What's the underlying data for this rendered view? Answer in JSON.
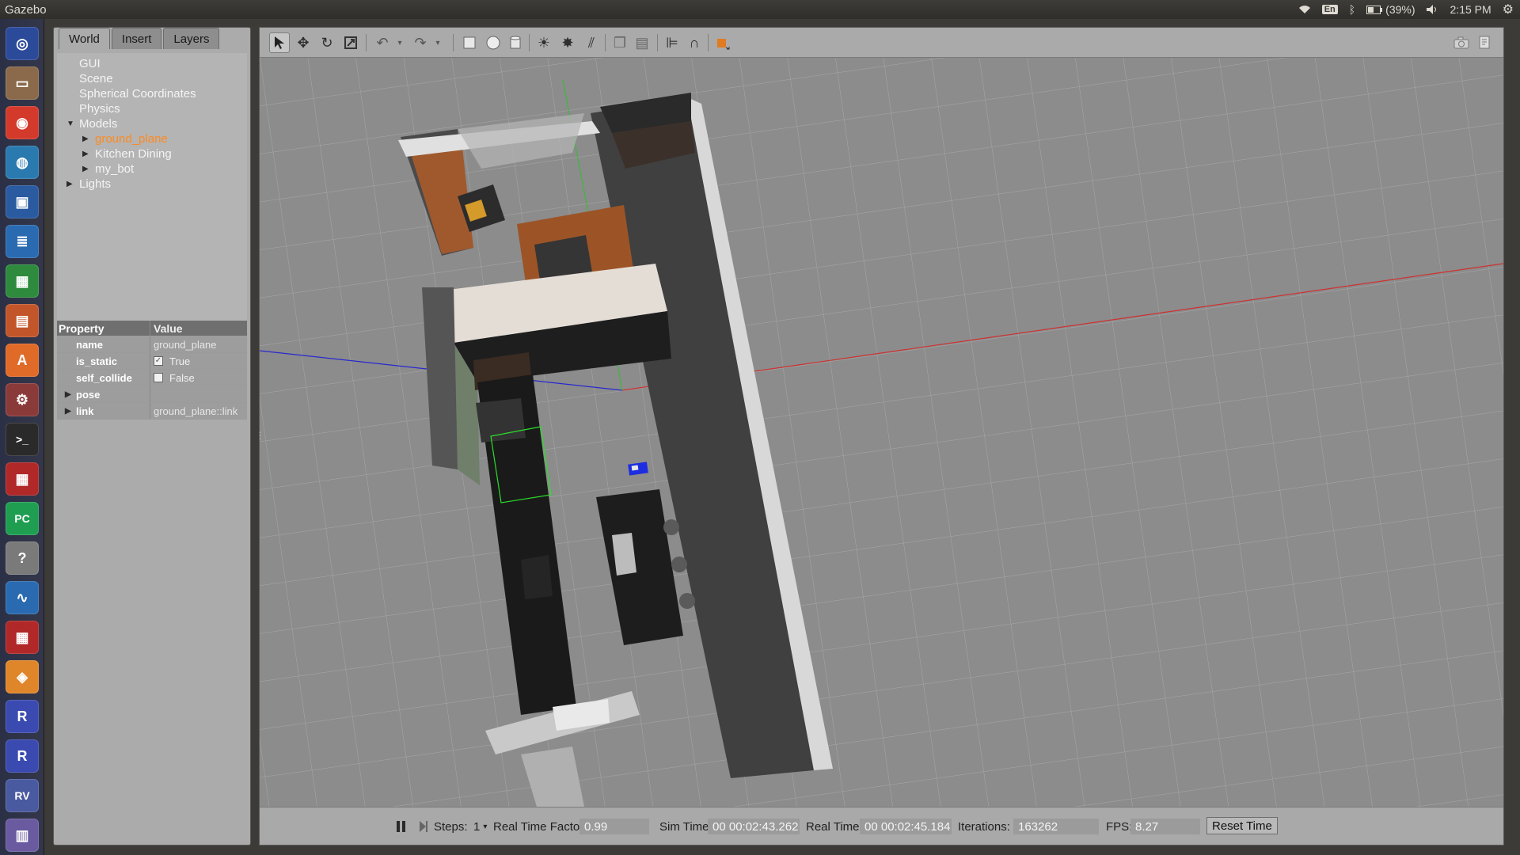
{
  "topbar": {
    "app_title": "Gazebo",
    "keyboard": "En",
    "battery": "(39%)",
    "clock": "2:15 PM"
  },
  "launcher": {
    "items": [
      {
        "name": "ubuntu-dash-icon",
        "color": "#2c4a9a",
        "glyph": "◎"
      },
      {
        "name": "files-icon",
        "color": "#8a6a4a",
        "glyph": "▭"
      },
      {
        "name": "chrome-icon",
        "color": "#d33a2c",
        "glyph": "◉"
      },
      {
        "name": "network-icon",
        "color": "#2a7ab0",
        "glyph": "◍"
      },
      {
        "name": "virtualbox-icon",
        "color": "#2a5aa0",
        "glyph": "▣"
      },
      {
        "name": "writer-icon",
        "color": "#2a6ab0",
        "glyph": "≣"
      },
      {
        "name": "calc-icon",
        "color": "#2e8b3e",
        "glyph": "▦"
      },
      {
        "name": "impress-icon",
        "color": "#c2562a",
        "glyph": "▤"
      },
      {
        "name": "software-center-icon",
        "color": "#e06a28",
        "glyph": "A"
      },
      {
        "name": "settings-icon",
        "color": "#8b3a3a",
        "glyph": "⚙"
      },
      {
        "name": "terminal-icon",
        "color": "#2a2a2a",
        "glyph": ">_"
      },
      {
        "name": "app-red-icon",
        "color": "#b02828",
        "glyph": "▦"
      },
      {
        "name": "pycharm-icon",
        "color": "#1f9e52",
        "glyph": "PC"
      },
      {
        "name": "help-icon",
        "color": "#7a7a7a",
        "glyph": "?"
      },
      {
        "name": "monitor-icon",
        "color": "#2a6ab0",
        "glyph": "∿"
      },
      {
        "name": "app-red-2-icon",
        "color": "#b02828",
        "glyph": "▦"
      },
      {
        "name": "gazebo-icon",
        "color": "#e0862a",
        "glyph": "◈"
      },
      {
        "name": "rqt-icon",
        "color": "#3a4ab0",
        "glyph": "R"
      },
      {
        "name": "rqt-2-icon",
        "color": "#3a4ab0",
        "glyph": "R"
      },
      {
        "name": "rviz-icon",
        "color": "#4a5aa0",
        "glyph": "RV"
      },
      {
        "name": "trash-icon",
        "color": "#6a5aa0",
        "glyph": "▥"
      }
    ]
  },
  "tabs": [
    "World",
    "Insert",
    "Layers"
  ],
  "tree": {
    "gui": "GUI",
    "scene": "Scene",
    "spherical": "Spherical Coordinates",
    "physics": "Physics",
    "models": "Models",
    "ground_plane": "ground_plane",
    "kitchen": "Kitchen Dining",
    "my_bot": "my_bot",
    "lights": "Lights"
  },
  "props": {
    "header_property": "Property",
    "header_value": "Value",
    "name_key": "name",
    "name_value": "ground_plane",
    "is_static_key": "is_static",
    "is_static_value": "True",
    "self_collide_key": "self_collide",
    "self_collide_value": "False",
    "pose_key": "pose",
    "link_key": "link",
    "link_value": "ground_plane::link"
  },
  "bottombar": {
    "steps_label": "Steps:",
    "steps_value": "1",
    "rtf_label": "Real Time Factor:",
    "rtf_value": "0.99",
    "sim_time_label": "Sim Time:",
    "sim_time_value": "00 00:02:43.262",
    "real_time_label": "Real Time:",
    "real_time_value": "00 00:02:45.184",
    "iterations_label": "Iterations:",
    "iterations_value": "163262",
    "fps_label": "FPS:",
    "fps_value": "8.27",
    "reset_label": "Reset Time"
  },
  "colors": {
    "selected_model": "#ff8a1e",
    "x_axis": "#d03030",
    "y_axis": "#30c030",
    "z_axis": "#2828d0",
    "bbox": "#2adf2a"
  }
}
